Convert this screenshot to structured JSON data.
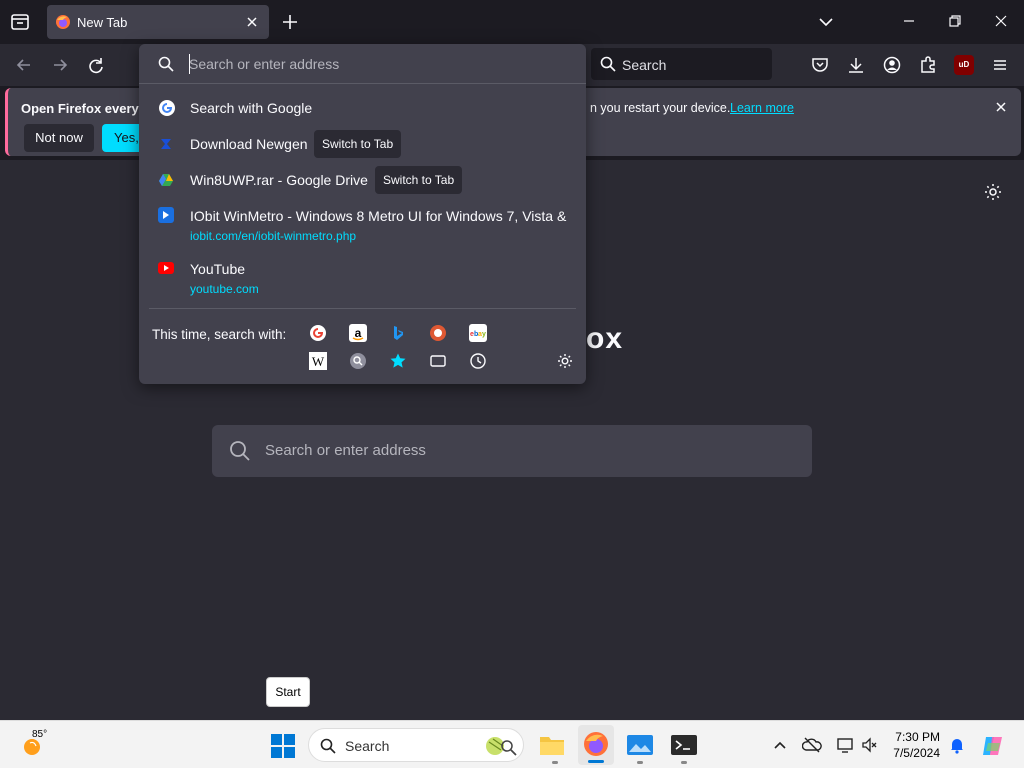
{
  "window": {
    "tab_title": "New Tab"
  },
  "toolbar": {
    "search_label": "Search",
    "extension_badge": "uD"
  },
  "notification": {
    "title": "Open Firefox every ti",
    "tail_text": "n you restart your device.",
    "learn_more": "Learn more",
    "not_now": "Not now",
    "yes": "Yes, c"
  },
  "urlbar": {
    "placeholder": "Search or enter address",
    "results": [
      {
        "title": "Search with Google",
        "url": "",
        "tab_action": ""
      },
      {
        "title": "Download Newgen",
        "url": "",
        "tab_action": "Switch to Tab"
      },
      {
        "title": "Win8UWP.rar - Google Drive",
        "url": "",
        "tab_action": "Switch to Tab"
      },
      {
        "title": "IObit WinMetro - Windows 8 Metro UI for Windows 7, Vista &",
        "url": "iobit.com/en/iobit-winmetro.php",
        "tab_action": ""
      },
      {
        "title": "YouTube",
        "url": "youtube.com",
        "tab_action": ""
      }
    ],
    "search_with_label": "This time, search with:",
    "engines": [
      "google-icon",
      "amazon-icon",
      "bing-icon",
      "duckduckgo-icon",
      "ebay-icon",
      "wikipedia-icon",
      "search-engine-icon",
      "bookmarks-icon",
      "tabs-icon",
      "history-icon"
    ]
  },
  "newtab": {
    "logo_text": "ox",
    "search_placeholder": "Search or enter address"
  },
  "tooltip": {
    "start": "Start"
  },
  "taskbar": {
    "temperature": "85°",
    "search_label": "Search",
    "time": "7:30 PM",
    "date": "7/5/2024"
  },
  "colors": {
    "accent": "#00ddff",
    "panel": "#42414d",
    "toolbar": "#2b2a33",
    "tabstrip": "#1c1b22"
  }
}
